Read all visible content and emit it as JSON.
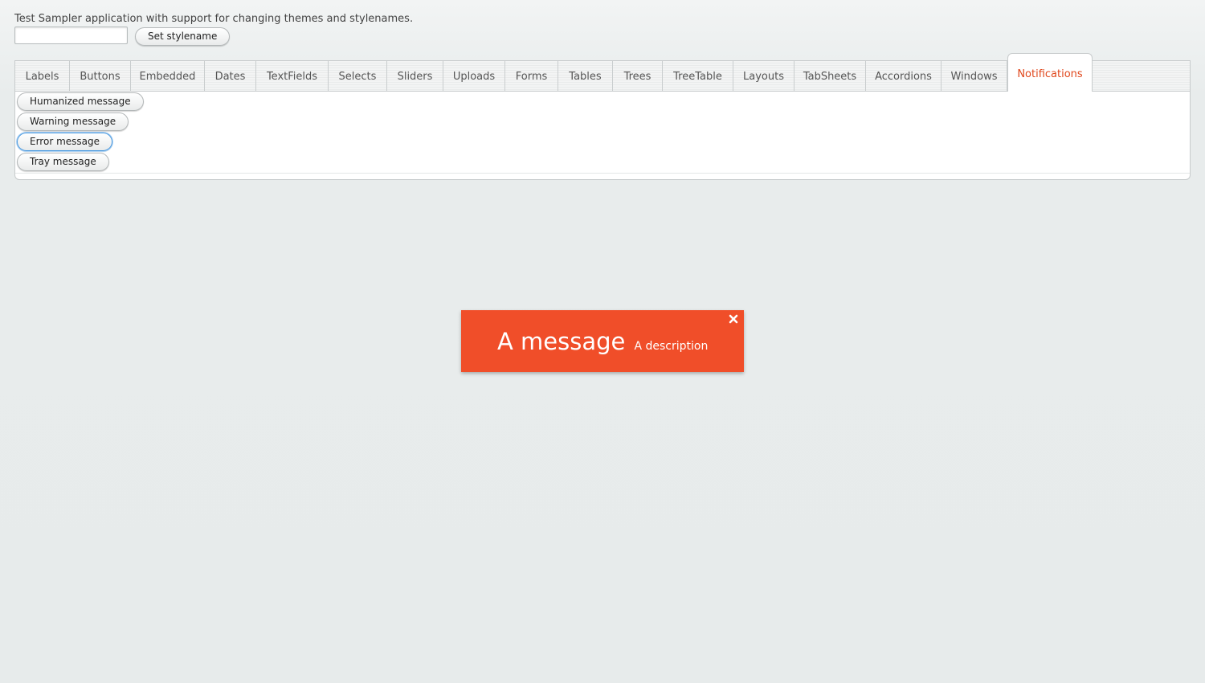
{
  "app": {
    "description": "Test Sampler application with support for changing themes and stylenames.",
    "stylename_input_value": "",
    "set_stylename_label": "Set stylename"
  },
  "tabs": [
    {
      "label": "Labels"
    },
    {
      "label": "Buttons"
    },
    {
      "label": "Embedded"
    },
    {
      "label": "Dates"
    },
    {
      "label": "TextFields"
    },
    {
      "label": "Selects"
    },
    {
      "label": "Sliders"
    },
    {
      "label": "Uploads"
    },
    {
      "label": "Forms"
    },
    {
      "label": "Tables"
    },
    {
      "label": "Trees"
    },
    {
      "label": "TreeTable"
    },
    {
      "label": "Layouts"
    },
    {
      "label": "TabSheets"
    },
    {
      "label": "Accordions"
    },
    {
      "label": "Windows"
    },
    {
      "label": "Notifications"
    }
  ],
  "selected_tab": "Notifications",
  "notification_buttons": {
    "humanized": "Humanized message",
    "warning": "Warning message",
    "error": "Error message",
    "tray": "Tray message"
  },
  "notification": {
    "caption": "A message",
    "description": "A description",
    "close_icon": "close-icon"
  },
  "colors": {
    "accent": "#e0471c",
    "notification_background": "#f04e29",
    "focus_ring": "#4d9be0"
  }
}
